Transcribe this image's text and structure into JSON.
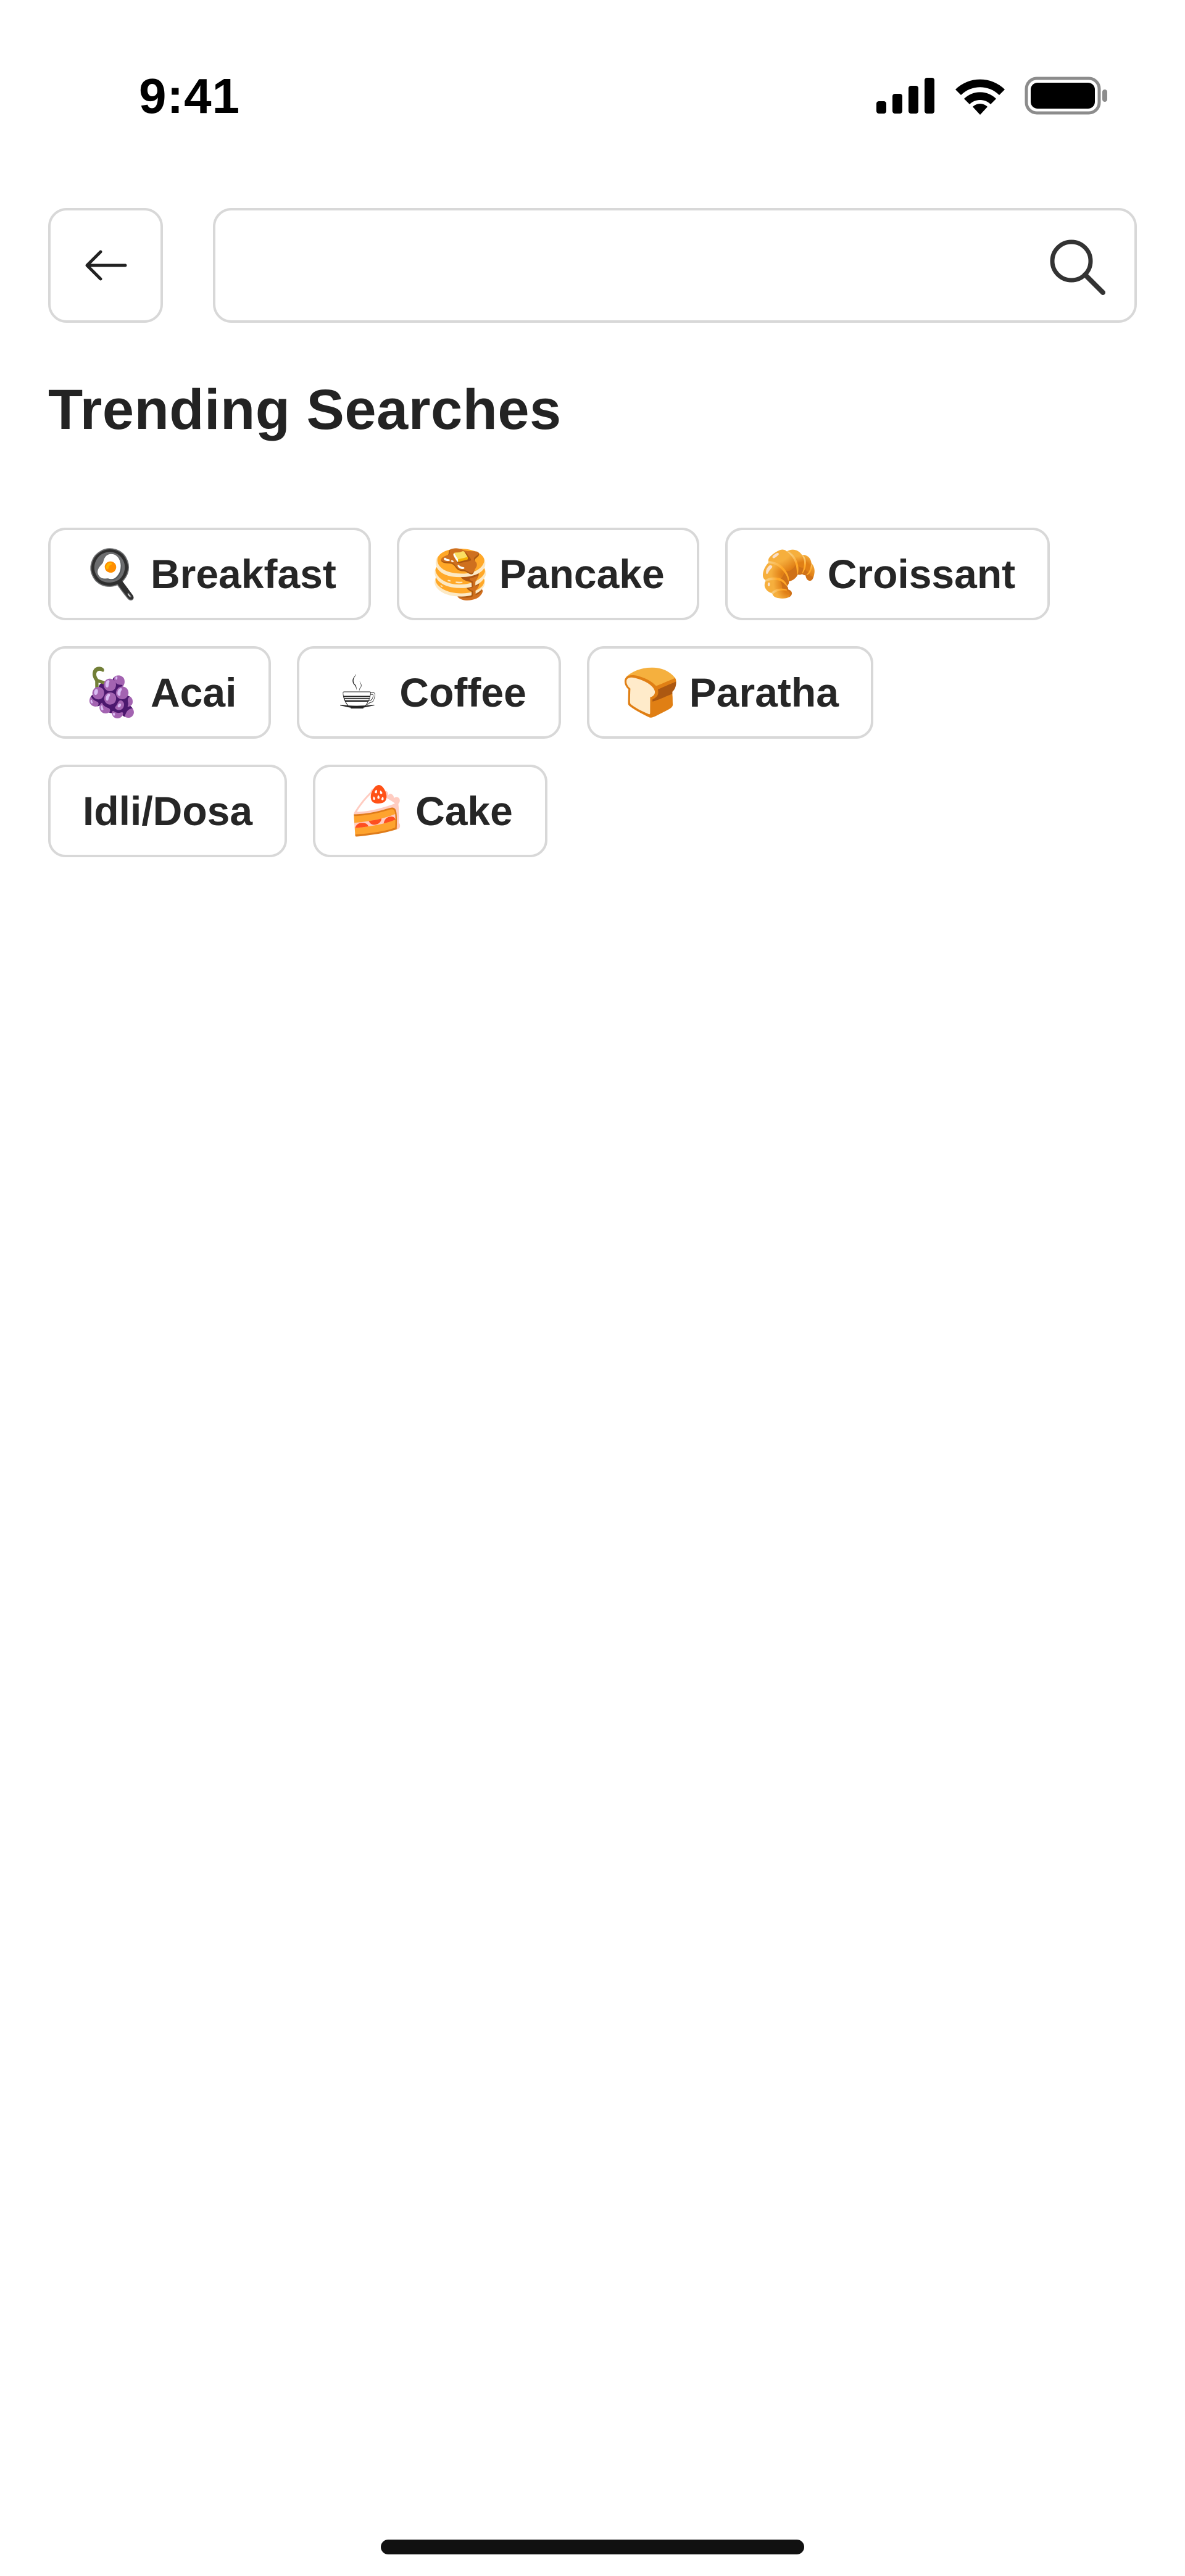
{
  "status_bar": {
    "time": "9:41"
  },
  "header": {
    "back_icon": "arrow-left-icon",
    "search": {
      "value": "",
      "placeholder": "",
      "icon": "search-icon"
    }
  },
  "trending": {
    "title": "Trending Searches",
    "chips": [
      {
        "emoji": "🍳",
        "label": "Breakfast"
      },
      {
        "emoji": "🥞",
        "label": "Pancake"
      },
      {
        "emoji": "🥐",
        "label": "Croissant"
      },
      {
        "emoji": "🍇",
        "label": "Acai"
      },
      {
        "emoji": "☕",
        "label": "Coffee"
      },
      {
        "emoji": "🍞",
        "label": "Paratha"
      },
      {
        "emoji": "",
        "label": "Idli/Dosa"
      },
      {
        "emoji": "🍰",
        "label": "Cake"
      }
    ]
  },
  "colors": {
    "border": "#d8d8d8",
    "text": "#222222",
    "background": "#ffffff"
  }
}
